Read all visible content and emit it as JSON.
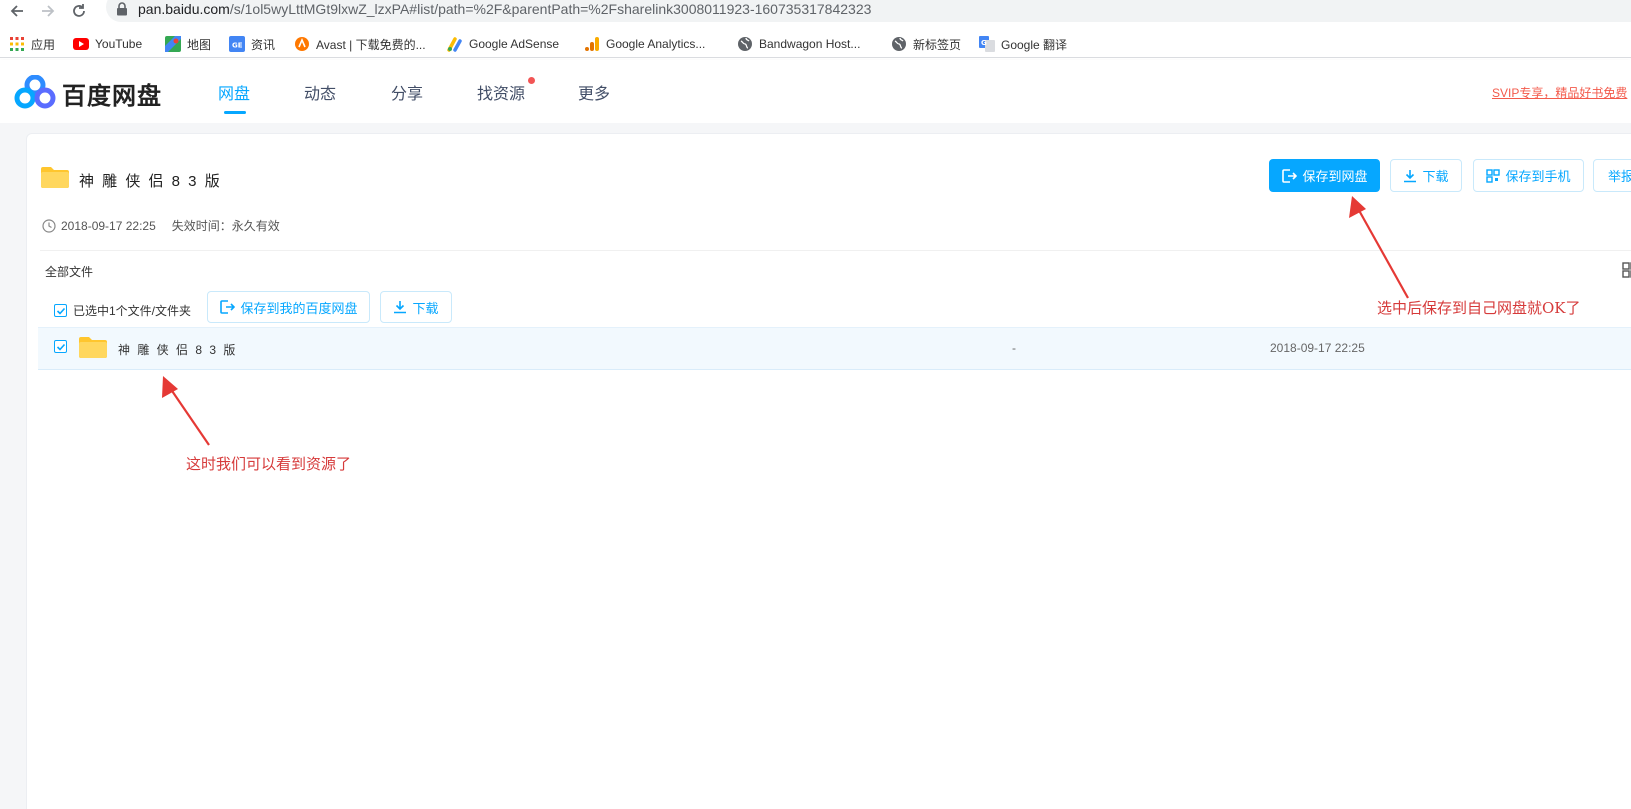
{
  "browser": {
    "url_host": "pan.baidu.com",
    "url_path": "/s/1ol5wyLttMGt9lxwZ_lzxPA#list/path=%2F&parentPath=%2Fsharelink3008011923-160735317842323",
    "bookmarks": [
      {
        "label": "应用",
        "icon": "apps-grid-icon"
      },
      {
        "label": "YouTube",
        "icon": "youtube-icon"
      },
      {
        "label": "地图",
        "icon": "maps-icon"
      },
      {
        "label": "资讯",
        "icon": "news-icon"
      },
      {
        "label": "Avast | 下载免费的...",
        "icon": "avast-icon"
      },
      {
        "label": "Google AdSense",
        "icon": "adsense-icon"
      },
      {
        "label": "Google Analytics...",
        "icon": "analytics-icon"
      },
      {
        "label": "Bandwagon Host...",
        "icon": "globe-icon"
      },
      {
        "label": "新标签页",
        "icon": "globe-icon"
      },
      {
        "label": "Google 翻译",
        "icon": "translate-icon"
      }
    ]
  },
  "header": {
    "logo_text": "百度网盘",
    "nav": [
      {
        "label": "网盘",
        "active": true
      },
      {
        "label": "动态",
        "active": false
      },
      {
        "label": "分享",
        "active": false
      },
      {
        "label": "找资源",
        "active": false
      },
      {
        "label": "更多",
        "active": false
      }
    ],
    "svip_text": "SVIP专享，精品好书免费",
    "accent": "#06a7ff"
  },
  "share": {
    "title": "神 雕 侠 侣 8 3 版",
    "created": "2018-09-17 22:25",
    "expire_label": "失效时间：",
    "expire_value": "永久有效",
    "actions": {
      "save": "保存到网盘",
      "download": "下载",
      "save_phone": "保存到手机",
      "report": "举报"
    }
  },
  "files": {
    "breadcrumb": "全部文件",
    "selection_text": "已选中1个文件/文件夹",
    "save_to_mine": "保存到我的百度网盘",
    "download": "下载",
    "rows": [
      {
        "name": "神 雕 侠 侣 8 3 版",
        "size": "-",
        "time": "2018-09-17 22:25",
        "checked": true
      }
    ]
  },
  "annotations": {
    "top_right": "选中后保存到自己网盘就OK了",
    "bottom_left": "这时我们可以看到资源了",
    "color": "#d63a3a"
  }
}
